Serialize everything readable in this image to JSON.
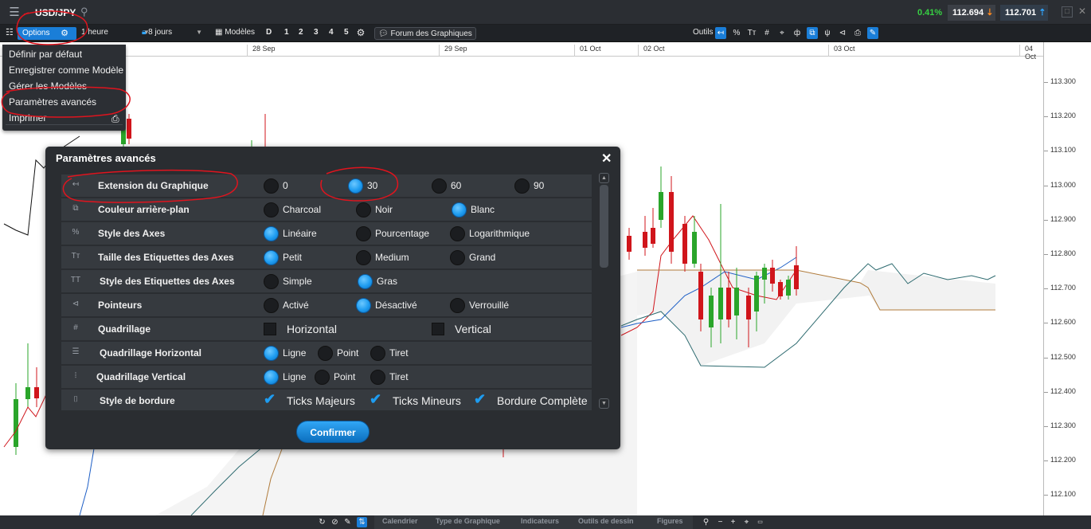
{
  "header": {
    "menu_icon": "hamburger-icon",
    "symbol": "USD/JPY",
    "change": "0.41%",
    "bid": "112.694",
    "ask": "112.701"
  },
  "toolbar": {
    "options_label": "Options",
    "interval_label": "1 heure",
    "range_label": "8 jours",
    "models_label": "Modèles",
    "periods": [
      "D",
      "1",
      "2",
      "3",
      "4",
      "5"
    ],
    "forum_label": "Forum des Graphiques",
    "tools_label": "Outils"
  },
  "dates": [
    "28 Sep",
    "29 Sep",
    "01 Oct",
    "02 Oct",
    "03 Oct",
    "04 Oct"
  ],
  "price_labels": [
    "113.300",
    "113.200",
    "113.100",
    "113.000",
    "112.900",
    "112.800",
    "112.700",
    "112.600",
    "112.500",
    "112.400",
    "112.300",
    "112.200",
    "112.100"
  ],
  "dropdown": {
    "items": [
      "Définir par défaut",
      "Enregistrer comme Modèle",
      "Gérer les Modèles",
      "Paramètres avancés",
      "Imprimer"
    ]
  },
  "modal": {
    "title": "Paramètres avancés",
    "confirm_label": "Confirmer",
    "rows": [
      {
        "label": "Extension du Graphique",
        "icon": "arrow-left-icon",
        "type": "radio",
        "options": [
          "0",
          "30",
          "60",
          "90"
        ],
        "selected": "30"
      },
      {
        "label": "Couleur arrière-plan",
        "icon": "windows-icon",
        "type": "radio",
        "options": [
          "Charcoal",
          "Noir",
          "Blanc"
        ],
        "selected": "Blanc"
      },
      {
        "label": "Style des Axes",
        "icon": "percent-icon",
        "type": "radio",
        "options": [
          "Linéaire",
          "Pourcentage",
          "Logarithmique"
        ],
        "selected": "Linéaire"
      },
      {
        "label": "Taille des Etiquettes des Axes",
        "icon": "text-size-icon",
        "type": "radio",
        "options": [
          "Petit",
          "Medium",
          "Grand"
        ],
        "selected": "Petit"
      },
      {
        "label": "Style des Etiquettes des Axes",
        "icon": "text-style-icon",
        "type": "radio",
        "options": [
          "Simple",
          "Gras"
        ],
        "selected": "Gras"
      },
      {
        "label": "Pointeurs",
        "icon": "pointer-icon",
        "type": "radio",
        "options": [
          "Activé",
          "Désactivé",
          "Verrouillé"
        ],
        "selected": "Désactivé"
      },
      {
        "label": "Quadrillage",
        "icon": "grid-icon",
        "type": "checkbox",
        "options": [
          "Horizontal",
          "Vertical"
        ],
        "checked": []
      },
      {
        "label": "Quadrillage Horizontal",
        "icon": "horizontal-lines-icon",
        "type": "radio",
        "options": [
          "Ligne",
          "Point",
          "Tiret"
        ],
        "selected": "Ligne"
      },
      {
        "label": "Quadrillage Vertical",
        "icon": "vertical-lines-icon",
        "type": "radio",
        "options": [
          "Ligne",
          "Point",
          "Tiret"
        ],
        "selected": "Ligne"
      },
      {
        "label": "Style de bordure",
        "icon": "border-icon",
        "type": "checkbox",
        "options": [
          "Ticks Majeurs",
          "Ticks Mineurs",
          "Bordure Complète"
        ],
        "checked": [
          "Ticks Majeurs",
          "Ticks Mineurs",
          "Bordure Complète"
        ]
      }
    ]
  },
  "bottom_tabs": [
    "Calendrier",
    "Type de Graphique",
    "Indicateurs",
    "Outils de dessin",
    "Figures"
  ],
  "colors": {
    "accent": "#1a7ed8",
    "positive": "#37d043",
    "bear_candle": "#d0151b",
    "bull_candle": "#2aa52a",
    "annotation": "#e0141e"
  }
}
